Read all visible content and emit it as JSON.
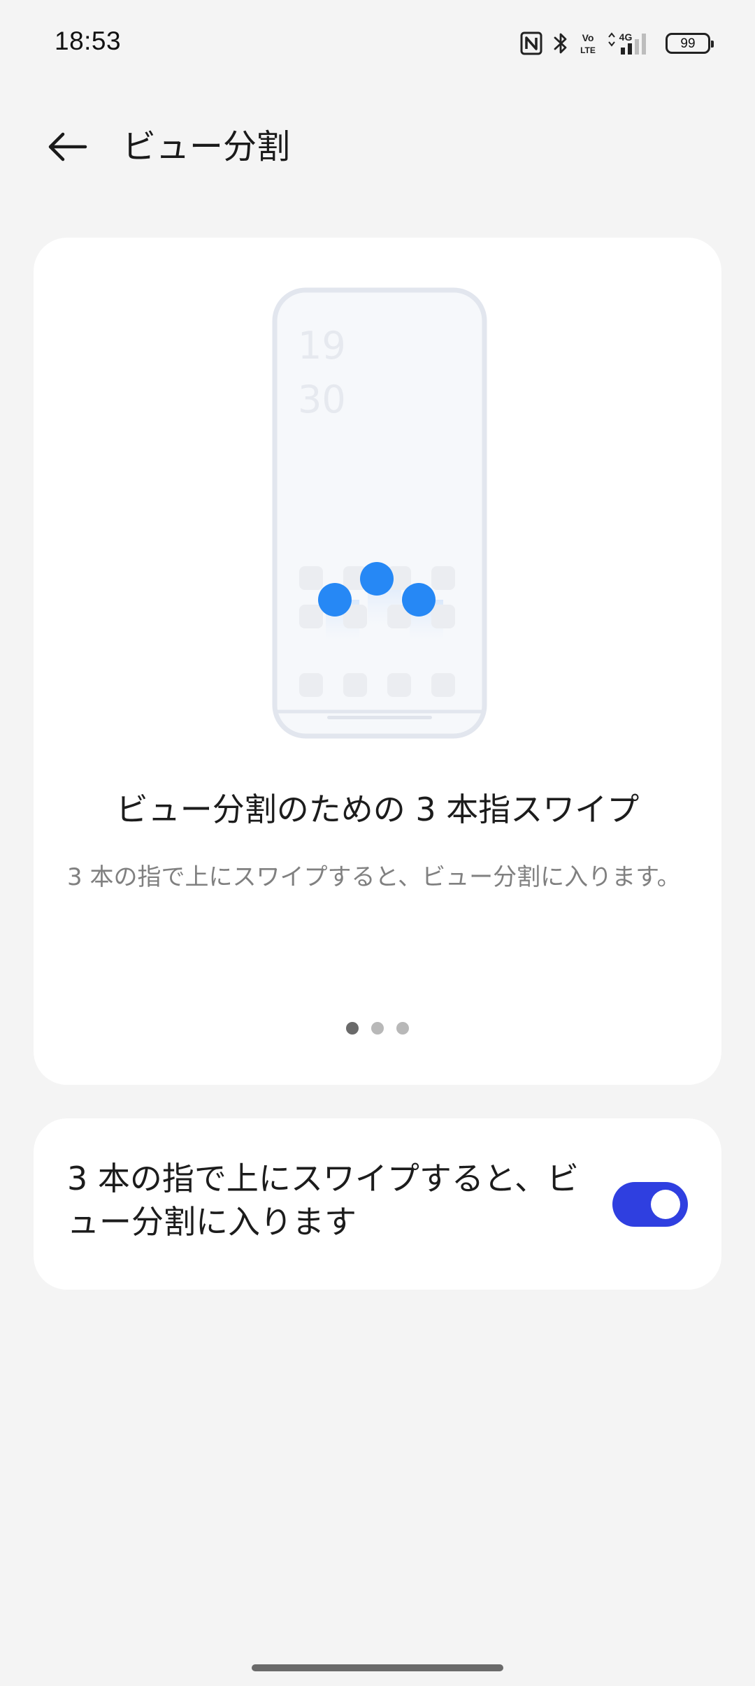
{
  "status_bar": {
    "time": "18:53",
    "battery_level": "99",
    "icons": [
      "nfc-icon",
      "bluetooth-icon",
      "volte-icon",
      "4g-icon",
      "signal-icon",
      "battery-icon"
    ],
    "volte_top": "Vo",
    "volte_bottom": "LTE",
    "network_label": "4G"
  },
  "header": {
    "back_icon": "arrow-left-icon",
    "title": "ビュー分割"
  },
  "intro_card": {
    "illustration": {
      "clock_hour": "19",
      "clock_minute": "30"
    },
    "title": "ビュー分割のための 3 本指スワイプ",
    "description": "3 本の指で上にスワイプすると、ビュー分割に入ります。",
    "page_count": 3,
    "active_page": 0
  },
  "toggle_card": {
    "label": "3 本の指で上にスワイプすると、ビュー分割に入ります",
    "enabled": true
  },
  "colors": {
    "background": "#f4f4f4",
    "card": "#ffffff",
    "accent": "#2f3fe0",
    "touch_dot": "#2688f5",
    "secondary_text": "#808080"
  }
}
